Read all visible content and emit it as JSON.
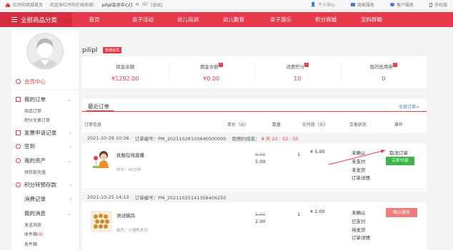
{
  "topbar": {
    "welcome_site": "红丹阳商城首页",
    "welcome_text": "欢迎来红丹阳在线商城!",
    "user_info": "pilipl会员中心[]",
    "messages": "(0)",
    "logout": "[退出]",
    "links": [
      {
        "label": "个人中心",
        "icon": "person-icon"
      },
      {
        "label": "商家服务",
        "icon": "store-icon"
      },
      {
        "label": "客户服务",
        "icon": "service-icon"
      },
      {
        "label": "手机版",
        "icon": "phone-icon"
      }
    ]
  },
  "nav": {
    "category_label": "全部商品分类",
    "items": [
      "首页",
      "亲子活动",
      "幼儿培训",
      "幼儿教育",
      "亲子游乐",
      "积分商城",
      "宝妈群聊"
    ]
  },
  "sidebar": {
    "member_center": "会员中心",
    "groups": [
      {
        "label": "我的订单",
        "subs": [
          "商品订单",
          "积分兑换订单"
        ]
      },
      {
        "label": "发票申请记录",
        "subs": []
      },
      {
        "label": "签到",
        "subs": []
      },
      {
        "label": "我的资产",
        "subs": [
          "预存款充值"
        ]
      },
      {
        "label": "积分转预存款",
        "subs": []
      },
      {
        "label": "消费记录",
        "subs": []
      },
      {
        "label": "我的消息",
        "subs": [
          "发送消息",
          "收件箱",
          "发件箱"
        ]
      }
    ],
    "inbox_count": "(0)"
  },
  "user": {
    "name": "pilipl",
    "level": "普通会员"
  },
  "stats": [
    {
      "label": "现金余额",
      "value": "¥1292.00",
      "has_q": false
    },
    {
      "label": "佣金余额",
      "value": "¥0.00",
      "has_q": true
    },
    {
      "label": "消费积分",
      "value": "10",
      "has_q": true
    },
    {
      "label": "我的抵用券",
      "value": "0",
      "has_q": true
    }
  ],
  "orders": {
    "title": "最近订单",
    "all_orders": "全部订单>",
    "headers": [
      "订单信息",
      "单价（元）",
      "数量",
      "实付款（元）",
      "交易状态",
      "操作"
    ],
    "list": [
      {
        "date": "2021-10-28 10:36",
        "order_no": "订单编号：PM_20211028103640500000",
        "countdown_label": "距预约结束：",
        "countdown": "8 天 23 : 52 : 55",
        "product": "抚触在线直播",
        "spec": "时长：40分钟",
        "orig_price": "6.00",
        "price": "5.00",
        "qty": "1",
        "paid": "¥ 5.00",
        "status": [
          "未确认",
          "未支付",
          "未发货",
          "订单详情"
        ],
        "actions": [
          "取消订单",
          "立即付款"
        ]
      },
      {
        "date": "2021-10-25 14:13",
        "order_no": "订单编号：PM_20211025141358406250",
        "product": "测试糕鸽",
        "spec": "颜色：小酒鸭系列",
        "orig_price": "5.00",
        "price": "2.00",
        "qty": "1",
        "paid": "¥ 2.00",
        "status": [
          "未确认",
          "已支付",
          "待发货",
          "订单详情"
        ],
        "actions": [
          "确认服务"
        ]
      }
    ]
  },
  "colors": {
    "accent": "#e8394a",
    "green": "#3cb548",
    "link": "#3a7bd5"
  }
}
